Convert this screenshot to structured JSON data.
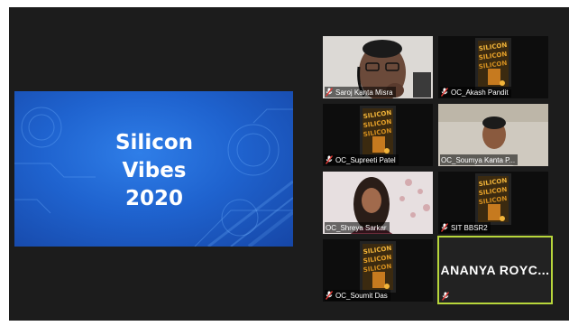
{
  "shared_screen": {
    "lines": [
      "Silicon",
      "Vibes",
      "2020"
    ]
  },
  "participants": [
    {
      "name": "Saroj Kanta Misra",
      "muted": true,
      "video": "camera"
    },
    {
      "name": "OC_Akash Pandit",
      "muted": true,
      "video": "poster"
    },
    {
      "name": "OC_Supreeti Patel",
      "muted": true,
      "video": "poster"
    },
    {
      "name": "OC_Soumya Kanta P...",
      "muted": false,
      "video": "camera"
    },
    {
      "name": "OC_Shreya Sarkar",
      "muted": false,
      "video": "camera"
    },
    {
      "name": "SIT BBSR2",
      "muted": true,
      "video": "poster"
    },
    {
      "name": "OC_Soumit Das",
      "muted": true,
      "video": "poster"
    },
    {
      "name": "ANANYA  ROYC...",
      "muted": true,
      "video": "name-only",
      "active_speaker": true
    }
  ],
  "colors": {
    "background": "#1c1c1c",
    "active_speaker_border": "#b7d63b",
    "muted_icon": "#e53935",
    "slide_blue": "#1f63cf"
  }
}
